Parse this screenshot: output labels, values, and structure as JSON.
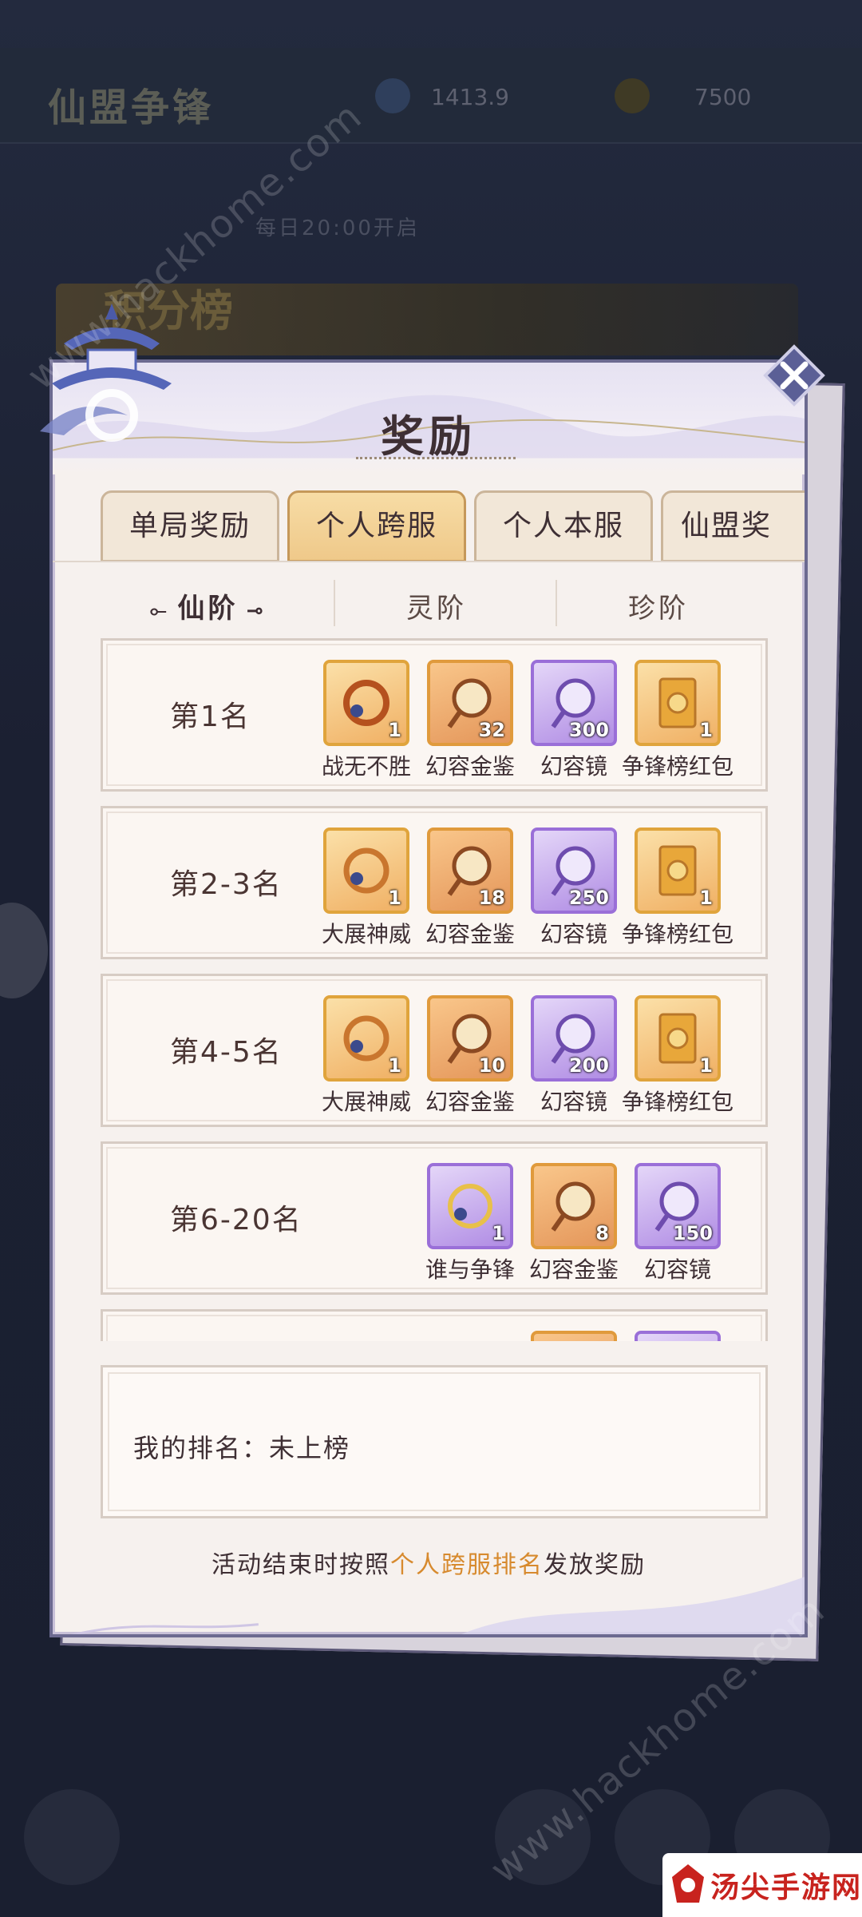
{
  "background": {
    "title": "仙盟争锋",
    "res1": "1413.9",
    "res2": "7500",
    "subnav": "每日20:00开启",
    "banner": "积分榜"
  },
  "watermarks": [
    "www.hackhome.com",
    "www.hackhome.com"
  ],
  "modal": {
    "title": "奖励",
    "tabs": [
      {
        "label": "单局奖励",
        "active": false
      },
      {
        "label": "个人跨服",
        "active": true
      },
      {
        "label": "个人本服",
        "active": false
      },
      {
        "label": "仙盟奖",
        "active": false
      }
    ],
    "tiers": [
      {
        "label": "仙阶",
        "active": true
      },
      {
        "label": "灵阶",
        "active": false
      },
      {
        "label": "珍阶",
        "active": false
      }
    ],
    "ranks": [
      {
        "label": "第1名",
        "items": [
          {
            "name": "战无不胜",
            "qty": "1",
            "kind": "ring",
            "color": "gold"
          },
          {
            "name": "幻容金鉴",
            "qty": "32",
            "kind": "mirror",
            "color": "red"
          },
          {
            "name": "幻容镜",
            "qty": "300",
            "kind": "mirror",
            "color": "purple"
          },
          {
            "name": "争锋榜红包",
            "qty": "1",
            "kind": "envelope",
            "color": "gold"
          }
        ]
      },
      {
        "label": "第2-3名",
        "items": [
          {
            "name": "大展神威",
            "qty": "1",
            "kind": "ring",
            "color": "gold"
          },
          {
            "name": "幻容金鉴",
            "qty": "18",
            "kind": "mirror",
            "color": "red"
          },
          {
            "name": "幻容镜",
            "qty": "250",
            "kind": "mirror",
            "color": "purple"
          },
          {
            "name": "争锋榜红包",
            "qty": "1",
            "kind": "envelope",
            "color": "gold"
          }
        ]
      },
      {
        "label": "第4-5名",
        "items": [
          {
            "name": "大展神威",
            "qty": "1",
            "kind": "ring",
            "color": "gold"
          },
          {
            "name": "幻容金鉴",
            "qty": "10",
            "kind": "mirror",
            "color": "red"
          },
          {
            "name": "幻容镜",
            "qty": "200",
            "kind": "mirror",
            "color": "purple"
          },
          {
            "name": "争锋榜红包",
            "qty": "1",
            "kind": "envelope",
            "color": "gold"
          }
        ]
      },
      {
        "label": "第6-20名",
        "items": [
          {
            "name": "谁与争锋",
            "qty": "1",
            "kind": "ring",
            "color": "purple"
          },
          {
            "name": "幻容金鉴",
            "qty": "8",
            "kind": "mirror",
            "color": "red"
          },
          {
            "name": "幻容镜",
            "qty": "150",
            "kind": "mirror",
            "color": "purple"
          }
        ]
      }
    ],
    "my_rank_label": "我的排名：未上榜",
    "footer_before": "活动结束时按照",
    "footer_highlight": "个人跨服排名",
    "footer_after": "发放奖励"
  },
  "logo_text": "汤尖手游网",
  "colors": {
    "accent": "#d78a2e",
    "frame": "#6c6a90",
    "tab_active": "#efc98a",
    "purple_border": "#9a6fd8",
    "gold_border": "#e0a43c"
  }
}
